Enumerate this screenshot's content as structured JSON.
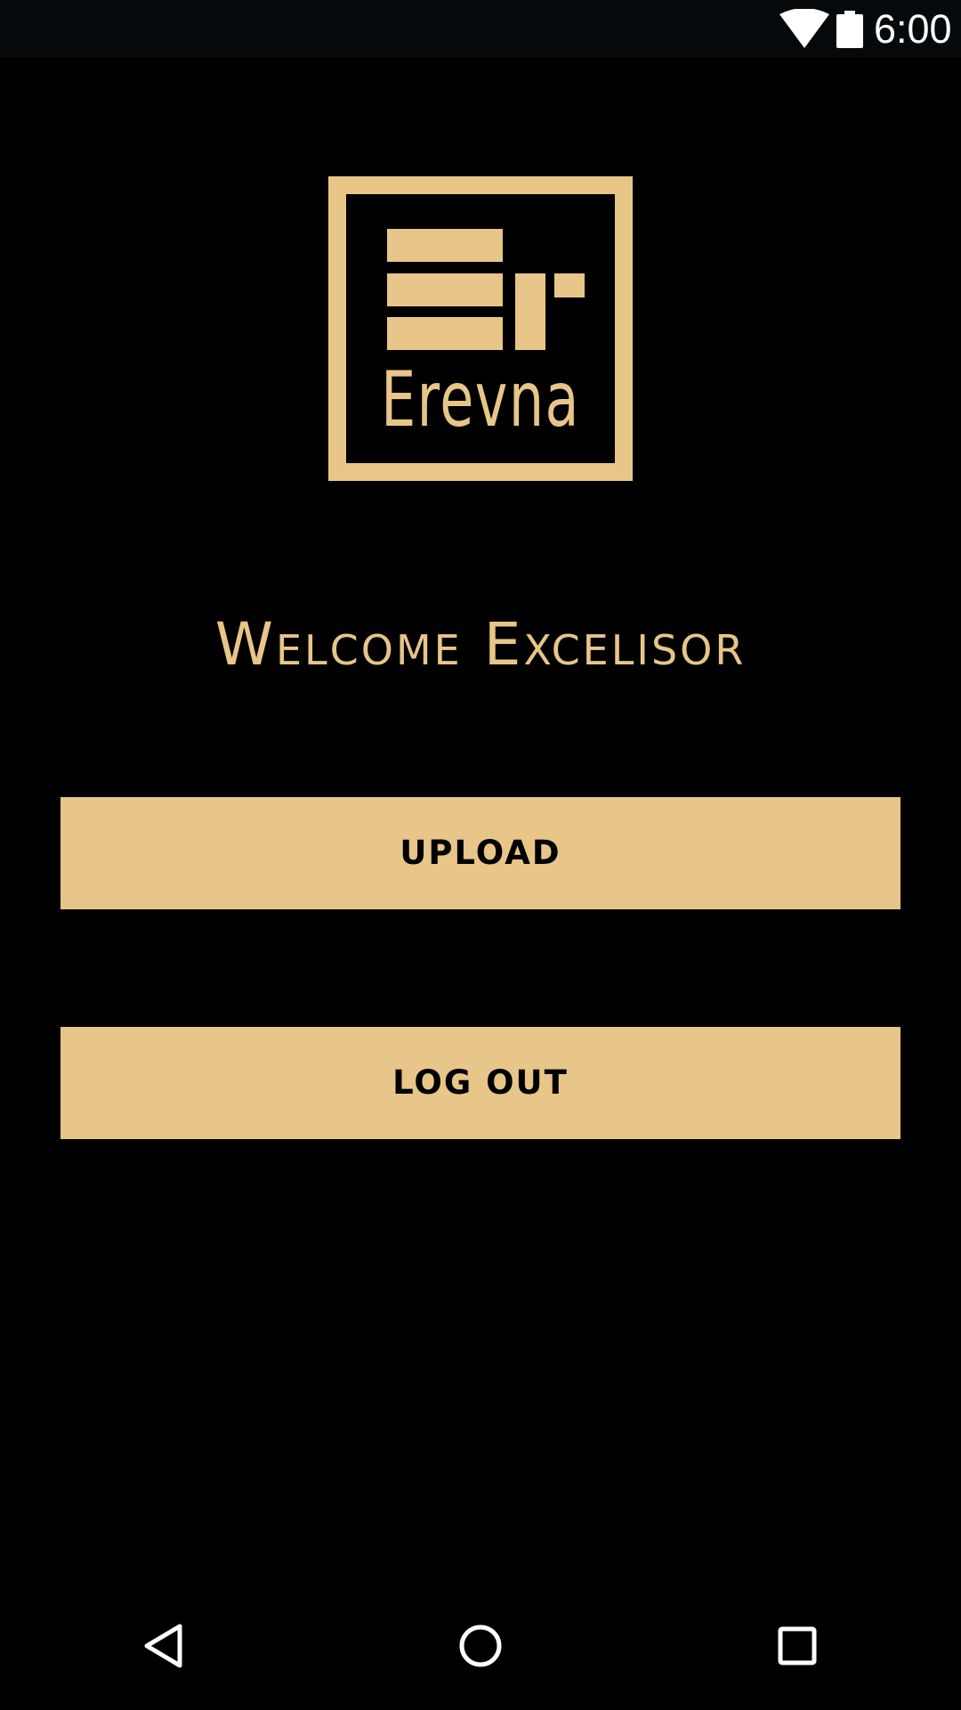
{
  "status_bar": {
    "time": "6:00",
    "icons": [
      "wifi-icon",
      "battery-icon"
    ]
  },
  "logo": {
    "text": "Erevna",
    "icon": "erevna-logo"
  },
  "welcome": {
    "text": "Welcome Excelisor"
  },
  "buttons": {
    "upload_label": "UPLOAD",
    "logout_label": "LOG OUT"
  },
  "nav_bar": {
    "icons": [
      "back-icon",
      "home-icon",
      "recents-icon"
    ]
  },
  "colors": {
    "accent": "#e8c588",
    "background": "#000000",
    "status_bar": "#06090b",
    "button_text": "#000000"
  }
}
